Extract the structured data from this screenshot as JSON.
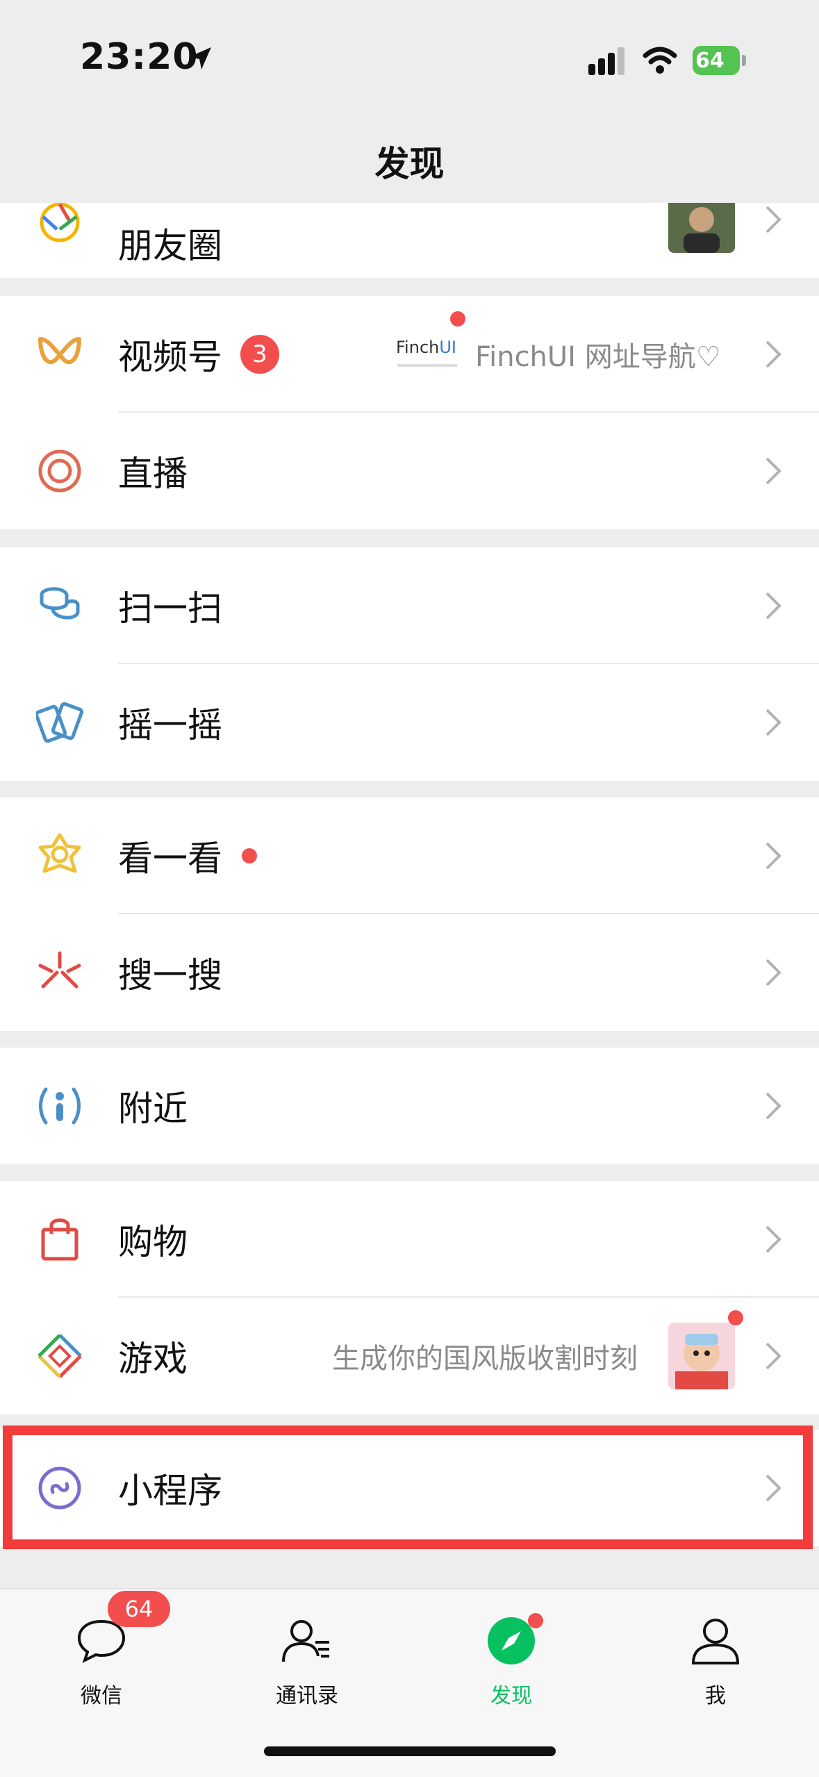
{
  "status_bar": {
    "time": "23:20",
    "battery": "64"
  },
  "nav": {
    "title": "发现"
  },
  "items": {
    "moments": {
      "label": "朋友圈"
    },
    "channels": {
      "label": "视频号",
      "badge": "3",
      "logo_text_a": "Finch",
      "logo_text_b": "UI",
      "subtitle": "FinchUI 网址导航♡"
    },
    "live": {
      "label": "直播"
    },
    "scan": {
      "label": "扫一扫"
    },
    "shake": {
      "label": "摇一摇"
    },
    "top_stories": {
      "label": "看一看"
    },
    "search": {
      "label": "搜一搜"
    },
    "nearby": {
      "label": "附近"
    },
    "shopping": {
      "label": "购物"
    },
    "games": {
      "label": "游戏",
      "subtitle": "生成你的国风版收割时刻"
    },
    "mini_programs": {
      "label": "小程序"
    }
  },
  "tabbar": {
    "chats": {
      "label": "微信",
      "badge": "64"
    },
    "contacts": {
      "label": "通讯录"
    },
    "discover": {
      "label": "发现"
    },
    "me": {
      "label": "我"
    }
  },
  "colors": {
    "accent": "#07c160",
    "badge": "#f24e4e",
    "highlight": "#f23b3b"
  }
}
